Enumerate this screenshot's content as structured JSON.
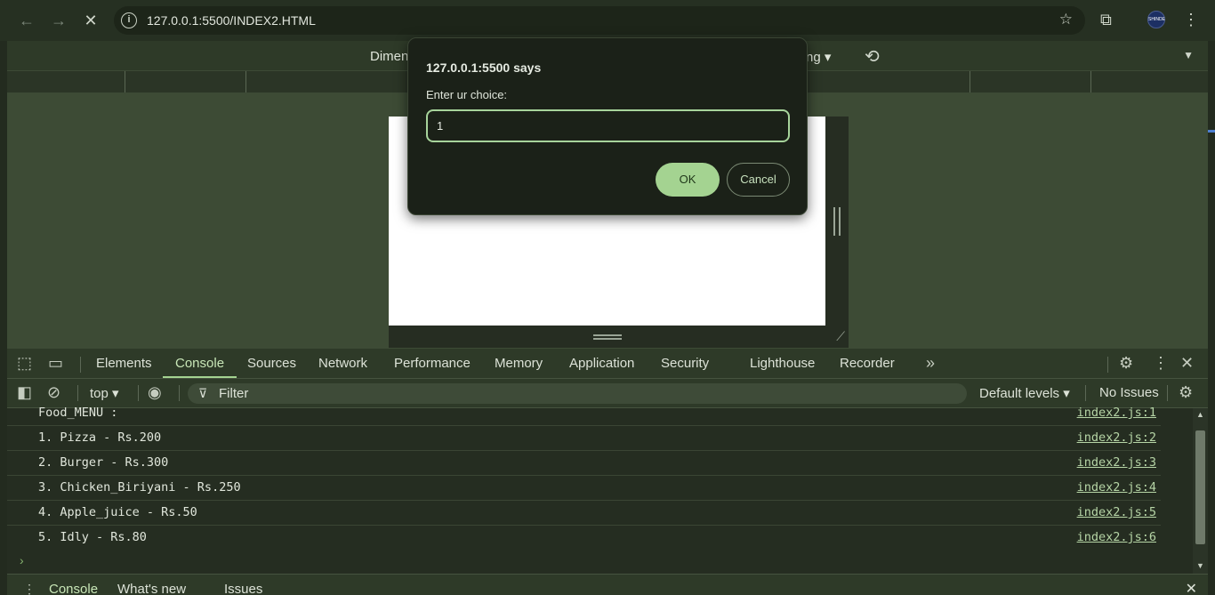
{
  "browser": {
    "url": "127.0.0.1:5500/INDEX2.HTML",
    "back_icon": "←",
    "forward_icon": "→",
    "stop_icon": "✕",
    "site_info_icon": "i",
    "star_icon": "☆",
    "extensions_icon": "⧉",
    "avatar_text": "SHINDE",
    "menu_icon": "⋮"
  },
  "device_toolbar": {
    "dimensions_label": "Dimen",
    "throttling_label": "ng ▾",
    "rotate_icon": "⟲",
    "more_icon": "▼"
  },
  "dialog": {
    "title": "127.0.0.1:5500 says",
    "message": "Enter ur choice:",
    "input_value": "1",
    "ok_label": "OK",
    "cancel_label": "Cancel"
  },
  "devtools": {
    "inspect_icon": "⬚",
    "device_icon": "▭",
    "tabs": [
      "Elements",
      "Console",
      "Sources",
      "Network",
      "Performance",
      "Memory",
      "Application",
      "Security",
      "Lighthouse",
      "Recorder"
    ],
    "active_tab": "Console",
    "more_tabs_icon": "»",
    "settings_icon": "⚙",
    "kebab_icon": "⋮",
    "close_icon": "✕"
  },
  "console_bar": {
    "sidebar_icon": "◧",
    "clear_icon": "⊘",
    "context": "top ▾",
    "eye_icon": "◉",
    "filter_icon": "⊽",
    "filter_placeholder": "Filter",
    "levels": "Default levels ▾",
    "issues": "No Issues",
    "settings_icon": "⚙"
  },
  "console_lines": [
    {
      "text": "Food_MENU :",
      "source": "index2.js:1"
    },
    {
      "text": "1. Pizza - Rs.200",
      "source": "index2.js:2"
    },
    {
      "text": "2. Burger - Rs.300",
      "source": "index2.js:3"
    },
    {
      "text": "3. Chicken_Biriyani - Rs.250",
      "source": "index2.js:4"
    },
    {
      "text": "4. Apple_juice - Rs.50",
      "source": "index2.js:5"
    },
    {
      "text": "5. Idly - Rs.80",
      "source": "index2.js:6"
    }
  ],
  "console_prompt": "›",
  "drawer": {
    "menu_icon": "⋮",
    "tabs": [
      "Console",
      "What's new",
      "Issues"
    ],
    "close_icon": "✕"
  }
}
